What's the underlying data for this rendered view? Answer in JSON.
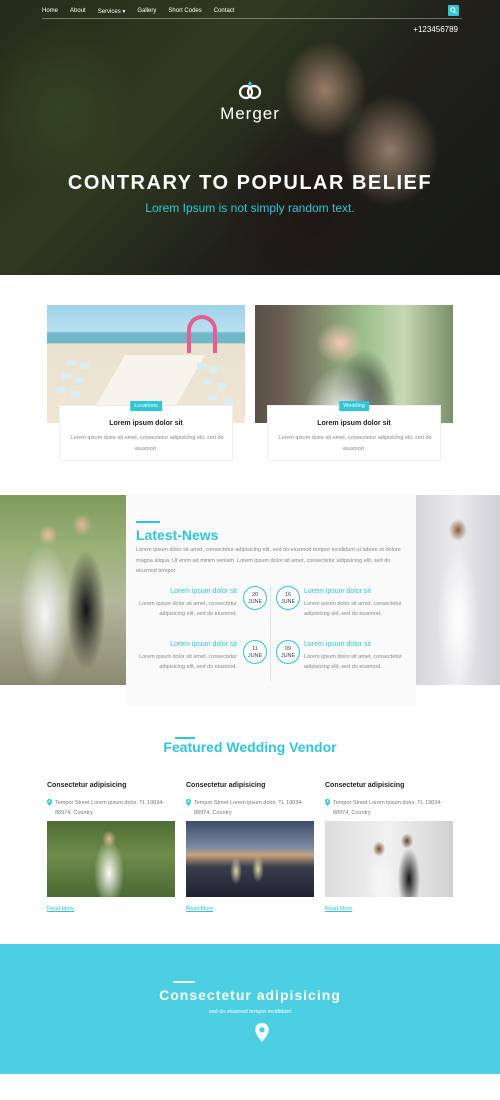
{
  "nav": {
    "items": [
      {
        "label": "Home"
      },
      {
        "label": "About"
      },
      {
        "label": "Services ▾"
      },
      {
        "label": "Gallery"
      },
      {
        "label": "Short Codes"
      },
      {
        "label": "Contact"
      }
    ],
    "phone": "+123456789"
  },
  "hero": {
    "logo_text": "Merger",
    "title": "CONTRARY TO POPULAR BELIEF",
    "subtitle": "Lorem Ipsum is not simply random text."
  },
  "features": [
    {
      "tag": "Locations",
      "title": "Lorem ipsum dolor sit",
      "text": "Lorem ipsum dolor sit amet, consectetur adipisicing elit, sed do eiusmod ."
    },
    {
      "tag": "Wedding",
      "title": "Lorem ipsum dolor sit",
      "text": "Lorem ipsum dolor sit amet, consectetur adipisicing elit, sed do eiusmod ."
    }
  ],
  "news": {
    "title": "Latest-News",
    "intro": "Lorem ipsum dolor sit amet, consectetur adipisicing elit, sed do eiusmod tempor incididunt ut labore et dolore magna aliqua. Ut enim ad minim veniam. Lorem ipsum dolor sit amet, consectetur adipisicing elit, sed do eiusmod tempor",
    "items": [
      {
        "title": "Lorem ipsum dolor sit",
        "text": "Lorem ipsum dolor sit amet, consectetur adipisicing elit, sed do eiusmod.",
        "day": "20",
        "month": "JUNE"
      },
      {
        "title": "Lorem ipsum dolor sit",
        "text": "Lorem ipsum dolor sit amet, consectetur adipisicing elit, sed do eiusmod.",
        "day": "16",
        "month": "JUNE"
      },
      {
        "title": "Lorem ipsum dolor sit",
        "text": "Lorem ipsum dolor sit amet, consectetur adipisicing elit, sed do eiusmod.",
        "day": "11",
        "month": "JUNE"
      },
      {
        "title": "Lorem ipsum dolor sit",
        "text": "Lorem ipsum dolor sit amet, consectetur adipisicing elit, sed do eiusmod.",
        "day": "09",
        "month": "JUNE"
      }
    ]
  },
  "vendors": {
    "title": "Featured Wedding Vendor",
    "items": [
      {
        "title": "Consectetur adipisicing",
        "address": "Tempor Street Lorem ipsum dolor, TL 19034-88974, Country",
        "link": "Read More"
      },
      {
        "title": "Consectetur adipisicing",
        "address": "Tempor Street Lorem ipsum dolor, TL 19034-88974, Country",
        "link": "Read More"
      },
      {
        "title": "Consectetur adipisicing",
        "address": "Tempor Street Lorem ipsum dolor, TL 19034-88974, Country",
        "link": "Read More"
      }
    ]
  },
  "contact": {
    "title": "Consectetur adipisicing",
    "subtitle": "sed do eiusmod tempor incididunt"
  },
  "colors": {
    "accent": "#30c6d9",
    "band": "#4ad0e2"
  },
  "icons": [
    "search-icon",
    "rings-icon",
    "location-pin-icon"
  ]
}
